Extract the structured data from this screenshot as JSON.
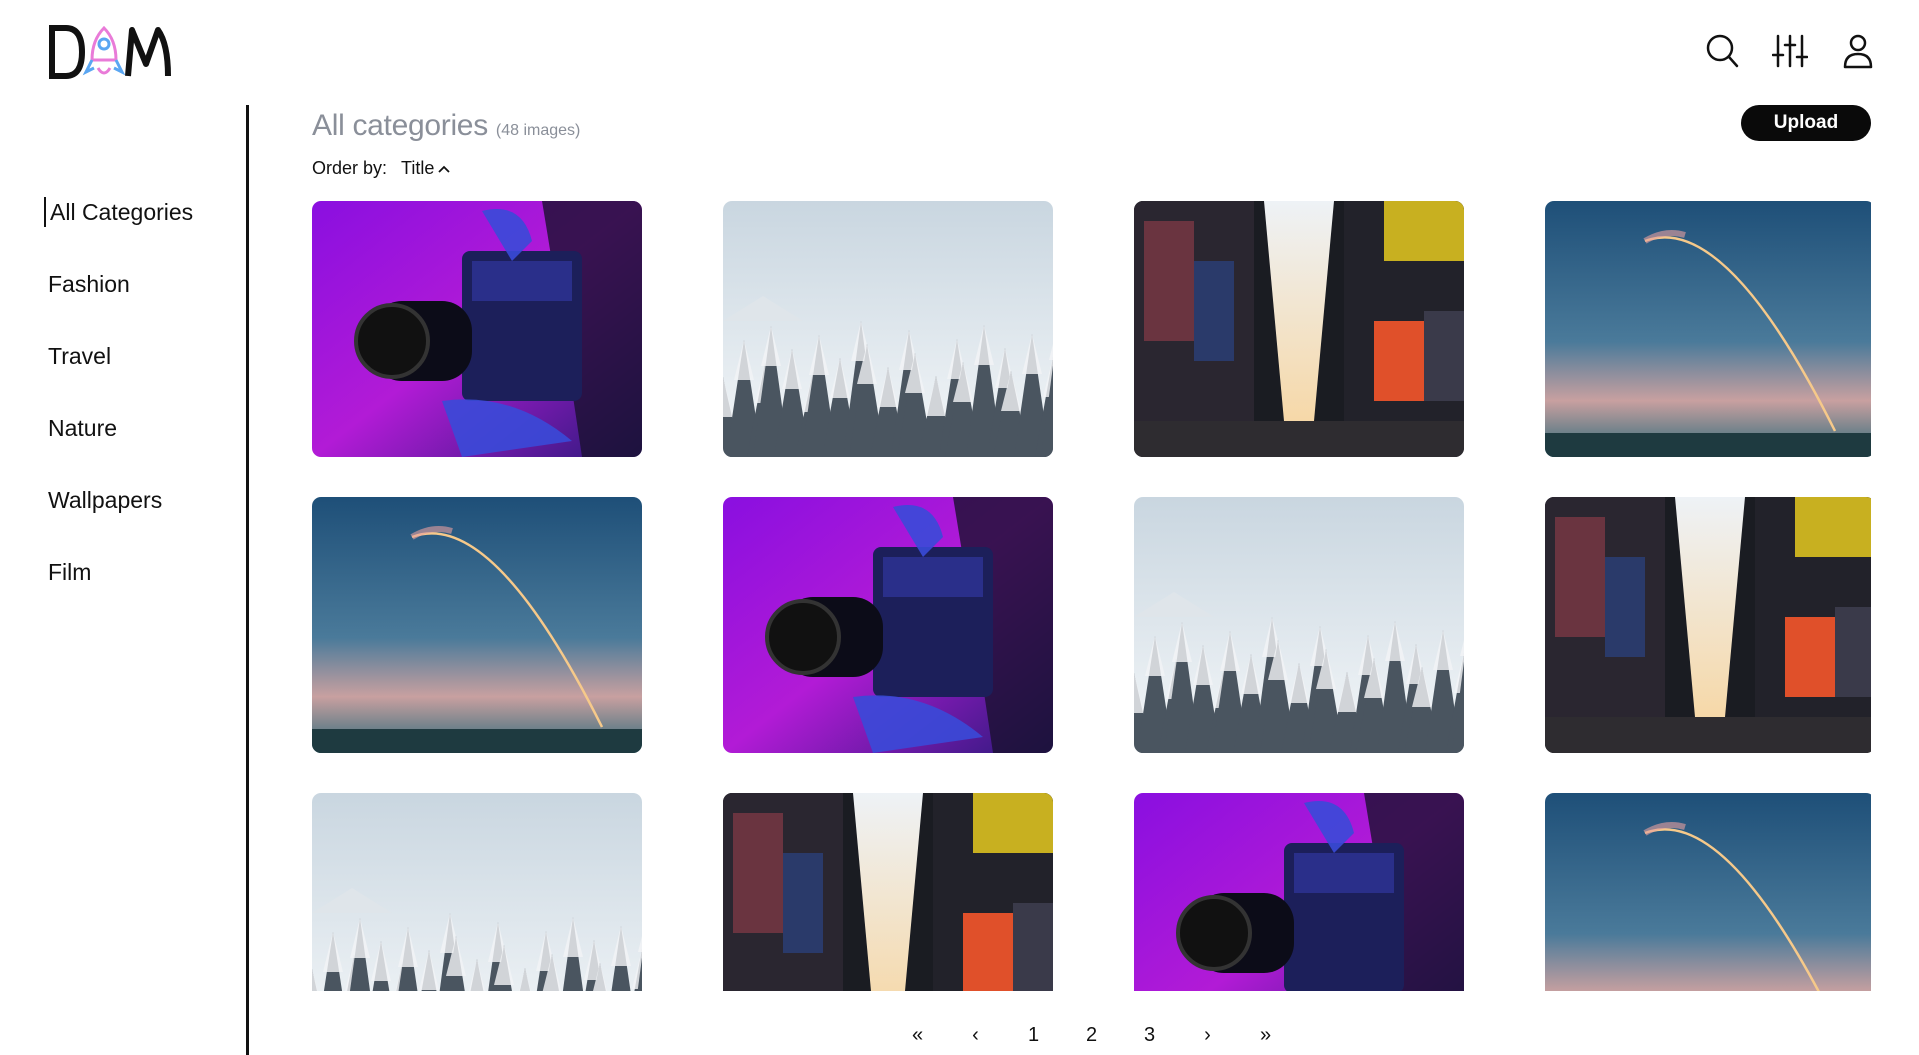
{
  "header": {
    "logo_text": "DAM",
    "icons": [
      "search-icon",
      "filter-sliders-icon",
      "user-icon"
    ]
  },
  "sidebar": {
    "items": [
      {
        "label": "All Categories",
        "active": true
      },
      {
        "label": "Fashion"
      },
      {
        "label": "Travel"
      },
      {
        "label": "Nature"
      },
      {
        "label": "Wallpapers"
      },
      {
        "label": "Film"
      }
    ]
  },
  "main": {
    "title": "All categories",
    "count": "(48 images)",
    "upload_label": "Upload",
    "order_label": "Order by:",
    "order_value": "Title",
    "order_direction_icon": "chevron-up-icon"
  },
  "gallery": {
    "images": [
      {
        "subject": "camera"
      },
      {
        "subject": "forest"
      },
      {
        "subject": "city"
      },
      {
        "subject": "rocket"
      },
      {
        "subject": "rocket"
      },
      {
        "subject": "camera"
      },
      {
        "subject": "forest"
      },
      {
        "subject": "city"
      },
      {
        "subject": "forest"
      },
      {
        "subject": "city"
      },
      {
        "subject": "camera"
      },
      {
        "subject": "rocket"
      }
    ]
  },
  "pagination": {
    "first": "«",
    "prev": "‹",
    "pages": [
      "1",
      "2",
      "3"
    ],
    "next": "›",
    "last": "»"
  },
  "colors": {
    "accent": "#0a0a0a",
    "muted_title": "#8a8f99",
    "logo_rocket_pink": "#e97bd8",
    "logo_rocket_blue": "#5aa6f2"
  }
}
